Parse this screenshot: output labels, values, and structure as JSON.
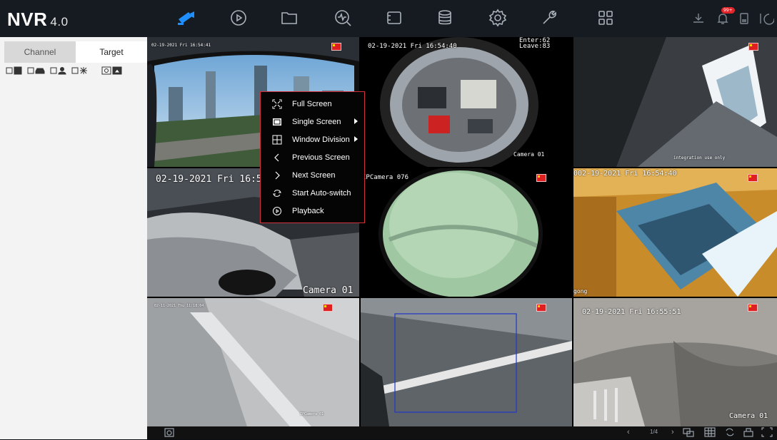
{
  "app": {
    "logo_name": "NVR",
    "logo_version": "4.0"
  },
  "topnav": [
    {
      "name": "live-view-icon",
      "active": true
    },
    {
      "name": "playback-icon"
    },
    {
      "name": "file-management-icon"
    },
    {
      "name": "smart-analysis-icon"
    },
    {
      "name": "configuration-icon"
    },
    {
      "name": "storage-icon"
    },
    {
      "name": "system-settings-icon"
    },
    {
      "name": "maintenance-icon"
    },
    {
      "name": "more-icon"
    }
  ],
  "top_right": {
    "alarm_badge": "99+"
  },
  "sidebar": {
    "tabs": [
      {
        "label": "Channel"
      },
      {
        "label": "Target"
      }
    ],
    "filters": [
      "face-filter-icon",
      "vehicle-filter-icon",
      "human-filter-icon",
      "motion-filter-icon",
      "picture-mode-icon"
    ]
  },
  "tiles": {
    "t1": {
      "timestamp": "02-19-2021 Fri 16:54:41"
    },
    "t2": {
      "timestamp": "02-19-2021 Fri 16:54:40",
      "enter": "Enter:62",
      "leave": "Leave:83",
      "camera": "Camera 01"
    },
    "t3": {
      "note": "integration use only"
    },
    "t4": {
      "timestamp": "02-19-2021 Fri 16:5",
      "camera": "Camera 01"
    },
    "t5": {
      "camera": "IPCamera 076"
    },
    "t6": {
      "timestamp": "002-19-2021 Fri 16:54:40",
      "camera": "gong"
    },
    "t7": {
      "timestamp": "02-11-2021 Thu 11:18:04",
      "camera": "IPCamera 01"
    },
    "t8": {},
    "t9": {
      "timestamp": "02-19-2021 Fri 16:55:51",
      "camera": "Camera 01"
    }
  },
  "context_menu": {
    "items": [
      {
        "label": "Full Screen",
        "icon": "fullscreen-icon",
        "submenu": false
      },
      {
        "label": "Single Screen",
        "icon": "single-screen-icon",
        "submenu": true
      },
      {
        "label": "Window Division",
        "icon": "window-division-icon",
        "submenu": true
      },
      {
        "label": "Previous Screen",
        "icon": "previous-icon",
        "submenu": false
      },
      {
        "label": "Next Screen",
        "icon": "next-icon",
        "submenu": false
      },
      {
        "label": "Start Auto-switch",
        "icon": "auto-switch-icon",
        "submenu": false
      },
      {
        "label": "Playback",
        "icon": "playback-icon",
        "submenu": false
      }
    ]
  },
  "bottom_bar": {
    "page": "1/4"
  },
  "colors": {
    "accent": "#1f8fff",
    "menu_border": "#d2303a",
    "sidebar_bg": "#f3f3f3"
  }
}
